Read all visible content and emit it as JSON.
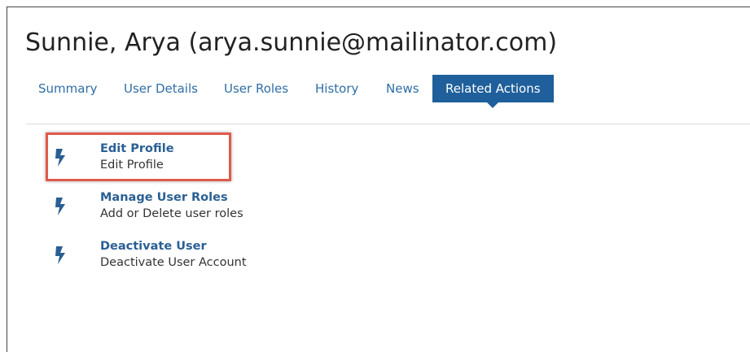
{
  "header": {
    "title": "Sunnie, Arya (arya.sunnie@mailinator.com)"
  },
  "tabs": [
    {
      "label": "Summary",
      "active": false
    },
    {
      "label": "User Details",
      "active": false
    },
    {
      "label": "User Roles",
      "active": false
    },
    {
      "label": "History",
      "active": false
    },
    {
      "label": "News",
      "active": false
    },
    {
      "label": "Related Actions",
      "active": true
    }
  ],
  "related_actions": [
    {
      "title": "Edit Profile",
      "description": "Edit Profile",
      "icon": "lightning-bolt-icon",
      "highlighted": true
    },
    {
      "title": "Manage User Roles",
      "description": "Add or Delete user roles",
      "icon": "lightning-bolt-icon",
      "highlighted": false
    },
    {
      "title": "Deactivate User",
      "description": "Deactivate User Account",
      "icon": "lightning-bolt-icon",
      "highlighted": false
    }
  ],
  "colors": {
    "accent": "#1f5f9b",
    "link": "#2a5f94",
    "highlight_border": "#e05a4a"
  }
}
